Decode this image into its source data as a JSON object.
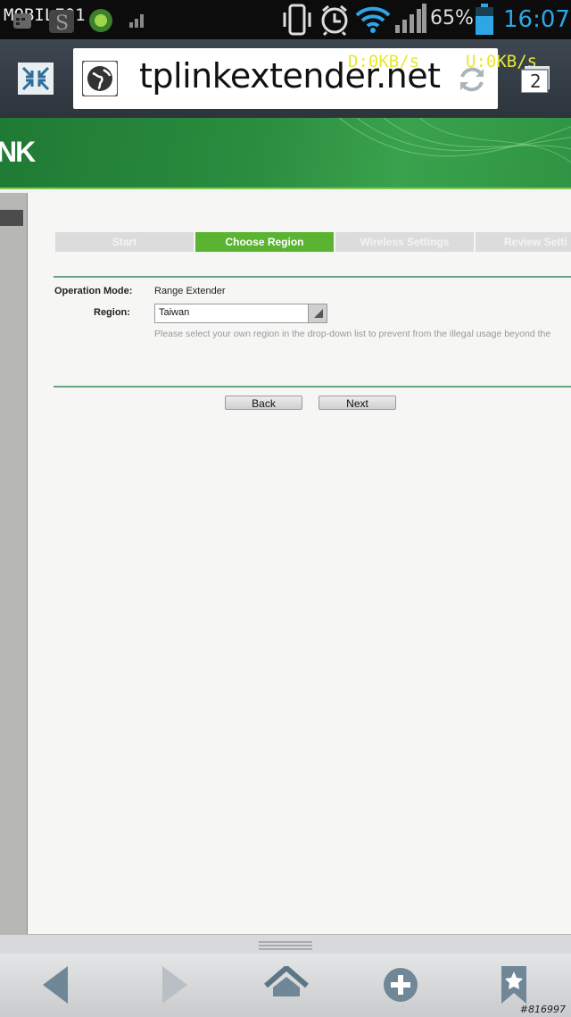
{
  "status_bar": {
    "logo_text": "MOBILE01",
    "battery_percent": "65%",
    "time": "16:07",
    "icons": [
      "calendar-icon",
      "s-app-icon",
      "android-icon",
      "signal-bars-icon",
      "vibrate-icon",
      "alarm-icon",
      "wifi-icon",
      "cell-signal-icon",
      "battery-icon"
    ]
  },
  "browser": {
    "url": "tplinkextender.net",
    "download_speed": "D:0KB/s",
    "upload_speed": "U:0KB/s",
    "tab_count": "2"
  },
  "banner": {
    "brand_fragment": "NK"
  },
  "wizard": {
    "steps": [
      {
        "label": "Start",
        "active": false
      },
      {
        "label": "Choose Region",
        "active": true
      },
      {
        "label": "Wireless Settings",
        "active": false
      },
      {
        "label": "Review Setti",
        "active": false
      }
    ],
    "operation_mode_label": "Operation Mode:",
    "operation_mode_value": "Range Extender",
    "region_label": "Region:",
    "region_value": "Taiwan",
    "hint": "Please select your own region in the drop-down list to prevent from the illegal usage beyond the",
    "back_label": "Back",
    "next_label": "Next",
    "active_color": "#5bb431"
  },
  "watermark": "#816997"
}
